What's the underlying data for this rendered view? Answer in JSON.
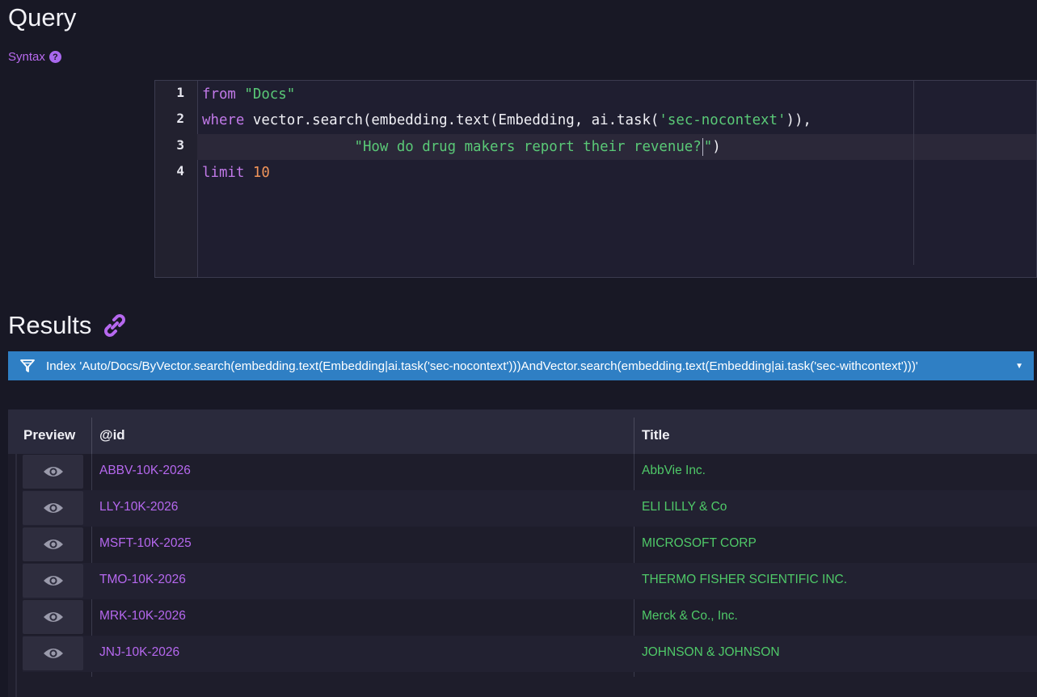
{
  "query": {
    "heading": "Query",
    "syntax_label": "Syntax",
    "help_glyph": "?",
    "line_numbers": [
      "1",
      "2",
      "3",
      "4"
    ],
    "code": {
      "l1_kw": "from",
      "l1_str": "\"Docs\"",
      "l2_kw": "where",
      "l2_a": "vector.search(embedding.text(Embedding, ai.task(",
      "l2_str": "'sec-nocontext'",
      "l2_b": ")),",
      "l3_str_a": "\"How do drug makers report their revenue?",
      "l3_str_b": "\"",
      "l3_b": ")",
      "l4_kw": "limit",
      "l4_num": "10"
    }
  },
  "results": {
    "heading": "Results",
    "index_text": "Index 'Auto/Docs/ByVector.search(embedding.text(Embedding|ai.task('sec-nocontext')))AndVector.search(embedding.text(Embedding|ai.task('sec-withcontext')))'",
    "columns": {
      "preview": "Preview",
      "id": "@id",
      "title": "Title"
    },
    "rows": [
      {
        "id": "ABBV-10K-2026",
        "title": "AbbVie Inc."
      },
      {
        "id": "LLY-10K-2026",
        "title": "ELI LILLY & Co"
      },
      {
        "id": "MSFT-10K-2025",
        "title": "MICROSOFT CORP"
      },
      {
        "id": "TMO-10K-2026",
        "title": "THERMO FISHER SCIENTIFIC INC."
      },
      {
        "id": "MRK-10K-2026",
        "title": "Merck & Co., Inc."
      },
      {
        "id": "JNJ-10K-2026",
        "title": "JOHNSON & JOHNSON"
      }
    ]
  },
  "colors": {
    "background": "#181825",
    "accent_purple": "#b668ef",
    "string_green": "#4fc968",
    "index_bar_blue": "#2f7fc4",
    "number_orange": "#f0945a"
  },
  "icons": [
    "help-icon",
    "link-icon",
    "filter-icon",
    "caret-down-icon",
    "eye-icon"
  ]
}
